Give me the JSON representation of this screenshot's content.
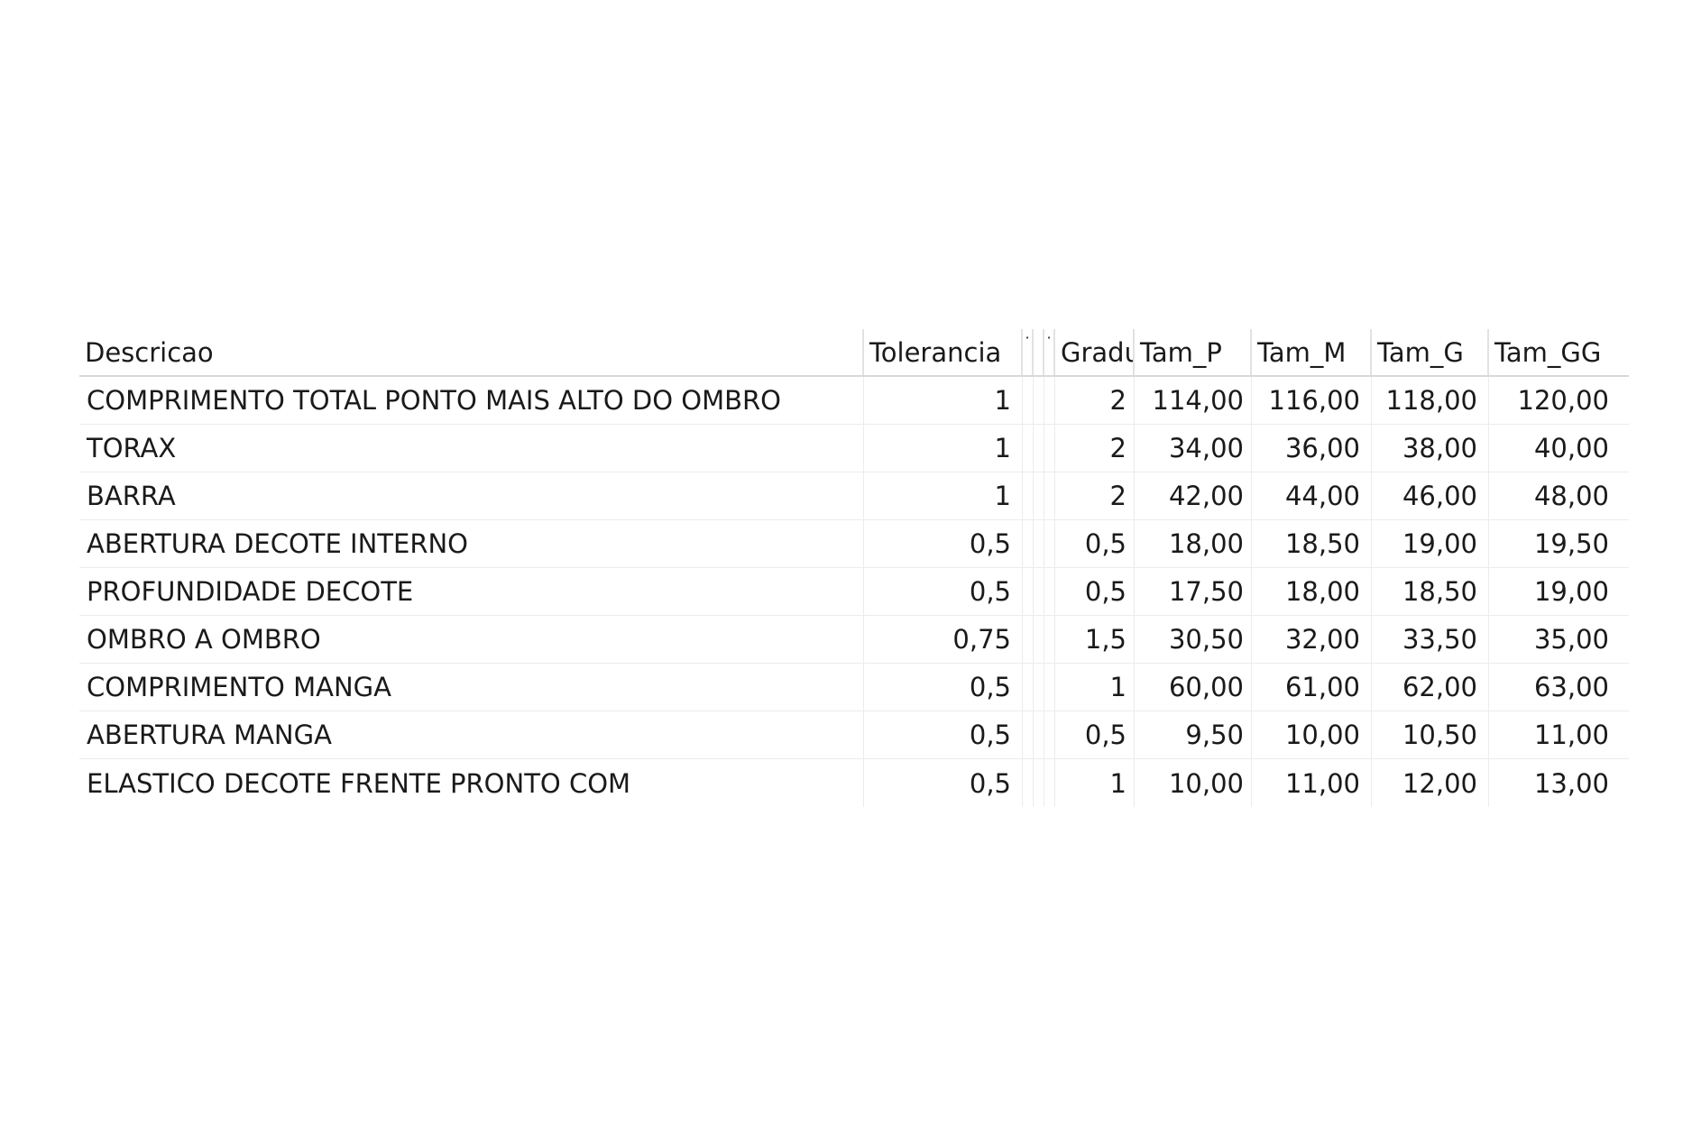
{
  "table": {
    "headers": {
      "descricao": "Descricao",
      "tolerancia": "Tolerancia",
      "hidden1": "·",
      "hidden2": "",
      "hidden3": "·",
      "gradu": "Gradu",
      "tam_p": "Tam_P",
      "tam_m": "Tam_M",
      "tam_g": "Tam_G",
      "tam_gg": "Tam_GG"
    },
    "rows": [
      {
        "descricao": "COMPRIMENTO TOTAL PONTO MAIS ALTO DO OMBRO",
        "tolerancia": "1",
        "gradu": "2",
        "tam_p": "114,00",
        "tam_m": "116,00",
        "tam_g": "118,00",
        "tam_gg": "120,00"
      },
      {
        "descricao": "TORAX",
        "tolerancia": "1",
        "gradu": "2",
        "tam_p": "34,00",
        "tam_m": "36,00",
        "tam_g": "38,00",
        "tam_gg": "40,00"
      },
      {
        "descricao": "BARRA",
        "tolerancia": "1",
        "gradu": "2",
        "tam_p": "42,00",
        "tam_m": "44,00",
        "tam_g": "46,00",
        "tam_gg": "48,00"
      },
      {
        "descricao": "ABERTURA DECOTE INTERNO",
        "tolerancia": "0,5",
        "gradu": "0,5",
        "tam_p": "18,00",
        "tam_m": "18,50",
        "tam_g": "19,00",
        "tam_gg": "19,50"
      },
      {
        "descricao": "PROFUNDIDADE DECOTE",
        "tolerancia": "0,5",
        "gradu": "0,5",
        "tam_p": "17,50",
        "tam_m": "18,00",
        "tam_g": "18,50",
        "tam_gg": "19,00"
      },
      {
        "descricao": "OMBRO A OMBRO",
        "tolerancia": "0,75",
        "gradu": "1,5",
        "tam_p": "30,50",
        "tam_m": "32,00",
        "tam_g": "33,50",
        "tam_gg": "35,00"
      },
      {
        "descricao": "COMPRIMENTO MANGA",
        "tolerancia": "0,5",
        "gradu": "1",
        "tam_p": "60,00",
        "tam_m": "61,00",
        "tam_g": "62,00",
        "tam_gg": "63,00"
      },
      {
        "descricao": "ABERTURA MANGA",
        "tolerancia": "0,5",
        "gradu": "0,5",
        "tam_p": "9,50",
        "tam_m": "10,00",
        "tam_g": "10,50",
        "tam_gg": "11,00"
      },
      {
        "descricao": "ELASTICO DECOTE FRENTE PRONTO COM",
        "tolerancia": "0,5",
        "gradu": "1",
        "tam_p": "10,00",
        "tam_m": "11,00",
        "tam_g": "12,00",
        "tam_gg": "13,00"
      }
    ]
  }
}
